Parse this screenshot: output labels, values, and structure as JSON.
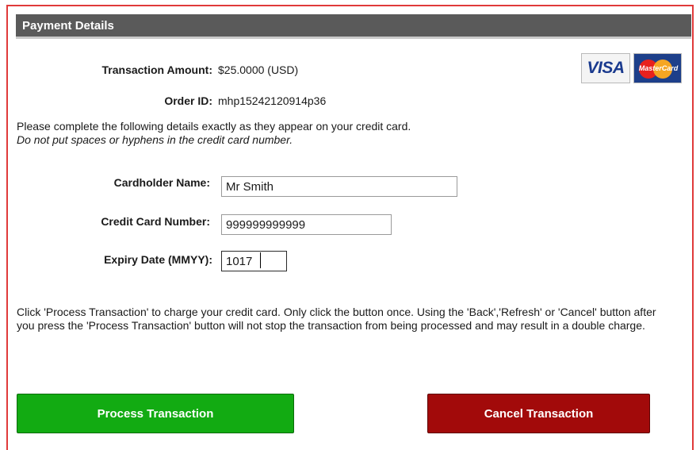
{
  "header": {
    "title": "Payment Details"
  },
  "transaction": {
    "amount_label": "Transaction Amount:",
    "amount_value": "$25.0000 (USD)",
    "order_label": "Order ID:",
    "order_value": "mhp15242120914p36"
  },
  "logos": {
    "visa": "VISA",
    "mastercard": "MasterCard"
  },
  "instructions": {
    "line1": "Please complete the following details exactly as they appear on your credit card.",
    "line2": "Do not put spaces or hyphens in the credit card number."
  },
  "form": {
    "cardholder_label": "Cardholder Name:",
    "cardholder_value": "Mr Smith",
    "card_number_label": "Credit Card Number:",
    "card_number_value": "999999999999",
    "expiry_label": "Expiry Date (MMYY):",
    "expiry_value": "1017"
  },
  "note": "Click 'Process Transaction' to charge your credit card. Only click the button once. Using the 'Back','Refresh' or 'Cancel' button after you press the 'Process Transaction' button will not stop the transaction from being processed and may result in a double charge.",
  "buttons": {
    "process": "Process Transaction",
    "cancel": "Cancel Transaction"
  },
  "colors": {
    "header_bg": "#5a5a5a",
    "process_button": "#12ab12",
    "cancel_button": "#a20a0a",
    "frame_border": "#e03a3a"
  },
  "icons": {
    "visa": "visa-logo-icon",
    "mastercard": "mastercard-logo-icon"
  }
}
